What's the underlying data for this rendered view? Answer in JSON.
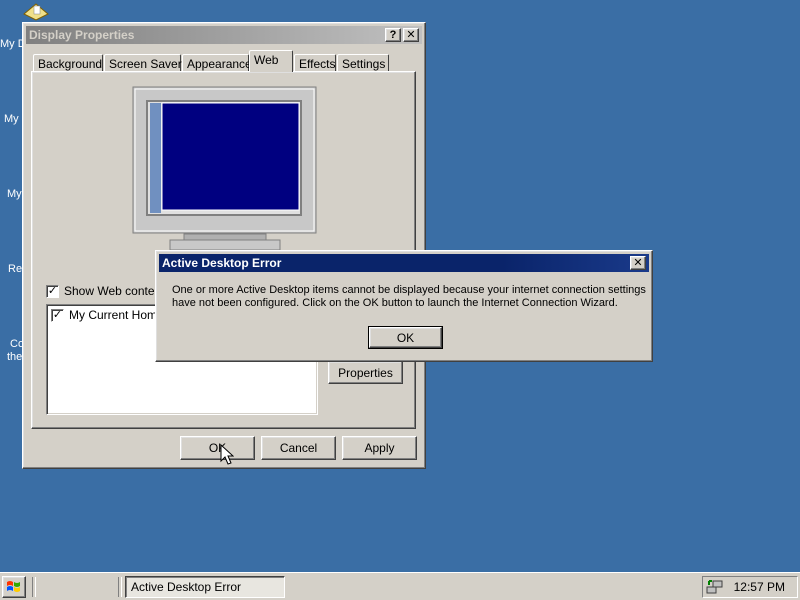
{
  "desktop": {
    "icon_labels": [
      "My D",
      "My",
      "My",
      "Re",
      "Co",
      "the"
    ]
  },
  "display_properties": {
    "title": "Display Properties",
    "help_button": "?",
    "close_button": "✕",
    "tabs": [
      {
        "label": "Background"
      },
      {
        "label": "Screen Saver"
      },
      {
        "label": "Appearance"
      },
      {
        "label": "Web"
      },
      {
        "label": "Effects"
      },
      {
        "label": "Settings"
      }
    ],
    "selected_tab": "Web",
    "show_web_content_label": "Show Web content",
    "show_web_content_checked": true,
    "web_items": [
      {
        "label": "My Current Home I",
        "checked": true
      }
    ],
    "properties_button": "Properties",
    "ok_button": "OK",
    "cancel_button": "Cancel",
    "apply_button": "Apply"
  },
  "error_dialog": {
    "title": "Active Desktop Error",
    "close_button": "✕",
    "message_line1": "One or more Active Desktop items cannot be displayed because your internet connection settings",
    "message_line2": "have not been configured. Click on the OK button to launch the Internet Connection Wizard.",
    "ok_button": "OK"
  },
  "taskbar": {
    "active_task": "Active Desktop Error",
    "clock": "12:57 PM"
  },
  "colors": {
    "desktop": "#3a6ea5",
    "active_title": "#0a246a",
    "inactive_title": "#808080",
    "monitor_screen": "#000080"
  }
}
